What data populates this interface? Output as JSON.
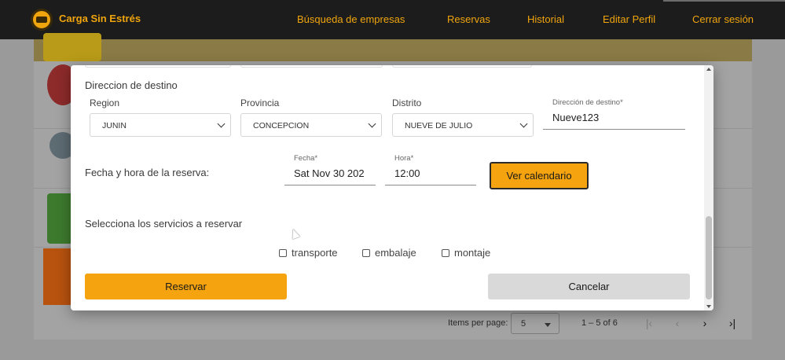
{
  "navbar": {
    "brand": "Carga Sin Estrés",
    "links": [
      "Búsqueda de empresas",
      "Reservas",
      "Historial",
      "Editar Perfil",
      "Cerrar sesión"
    ],
    "accent_color": "#f0a50e",
    "bg_color": "#1c1c1c"
  },
  "paginator": {
    "items_per_page_label": "Items per page:",
    "items_per_page_value": "5",
    "range": "1 – 5 of 6"
  },
  "modal": {
    "destination_title": "Direccion de destino",
    "region": {
      "label": "Region",
      "value": "JUNIN"
    },
    "provincia": {
      "label": "Provincia",
      "value": "CONCEPCION"
    },
    "distrito": {
      "label": "Distrito",
      "value": "NUEVE DE JULIO"
    },
    "direccion": {
      "label": "Dirección de destino*",
      "value": "Nueve123"
    },
    "datetime_title": "Fecha y hora de la reserva:",
    "fecha": {
      "label": "Fecha*",
      "value": "Sat Nov 30 202"
    },
    "hora": {
      "label": "Hora*",
      "value": "12:00"
    },
    "calendar_button": "Ver calendario",
    "services_title": "Selecciona los servicios a reservar",
    "services": [
      "transporte",
      "embalaje",
      "montaje"
    ],
    "reserve_button": "Reservar",
    "cancel_button": "Cancelar",
    "primary_color": "#f5a30f",
    "secondary_color": "#d9d9d9"
  }
}
